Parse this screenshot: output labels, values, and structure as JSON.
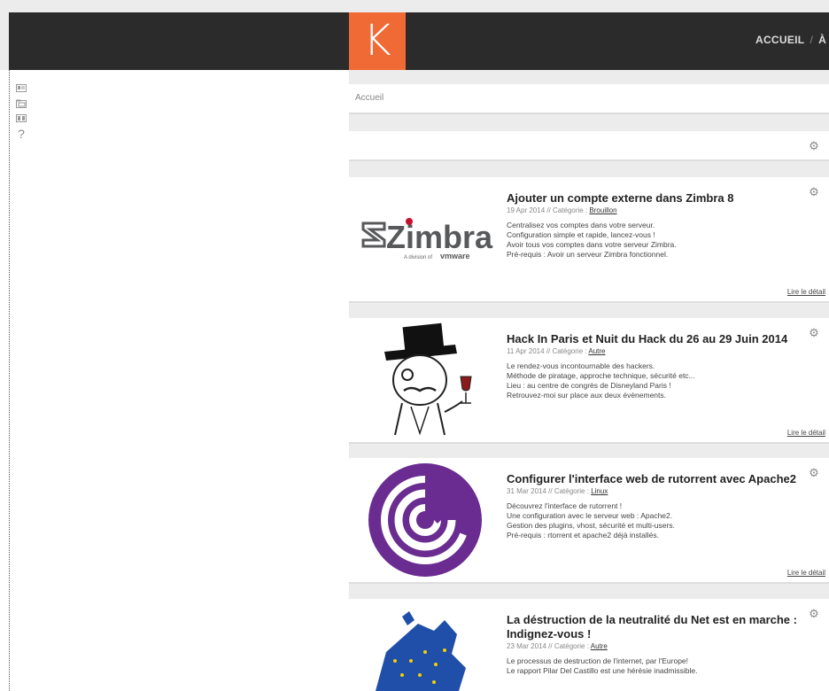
{
  "logo": "K",
  "nav": {
    "item1": "ACCUEIL",
    "sep": "/",
    "item2": "À"
  },
  "sidebar_icons": [
    "contact-card-icon",
    "folder-icon",
    "panel-icon",
    "help-icon"
  ],
  "help_glyph": "?",
  "breadcrumb": "Accueil",
  "gear_glyph": "⚙",
  "posts": [
    {
      "title": "Ajouter un compte externe dans Zimbra 8",
      "date": "19 Apr 2014",
      "cat_label": "Catégorie :",
      "category": "Brouillon",
      "desc": [
        "Centralisez vos comptes dans votre serveur.",
        "Configuration simple et rapide, lancez-vous !",
        "Avoir tous vos comptes dans votre serveur Zimbra.",
        "Pré-requis : Avoir un serveur Zimbra fonctionnel."
      ],
      "more": "Lire le détail",
      "thumb": {
        "brand": "Zimbra",
        "sub": "A division of",
        "sub2": "vmware"
      }
    },
    {
      "title": "Hack In Paris et Nuit du Hack du 26 au 29 Juin 2014",
      "date": "11 Apr 2014",
      "cat_label": "Catégorie :",
      "category": "Autre",
      "desc": [
        "Le rendez-vous incontournable des hackers.",
        "Méthode de piratage, approche technique, sécurité etc...",
        "Lieu : au centre de congrès de Disneyland Paris !",
        "Retrouvez-moi sur place aux deux évènements."
      ],
      "more": "Lire le détail"
    },
    {
      "title": "Configurer l'interface web de rutorrent avec Apache2",
      "date": "31 Mar 2014",
      "cat_label": "Catégorie :",
      "category": "Linux",
      "desc": [
        "Découvrez l'interface de rutorrent !",
        "Une configuration avec le serveur web : Apache2.",
        "Gestion des plugins, vhost, sécurité et multi-users.",
        "Pré-requis : rtorrent et apache2 déjà installés."
      ],
      "more": "Lire le détail"
    },
    {
      "title": "La déstruction de la neutralité du Net est en marche : Indignez-vous !",
      "date": "23 Mar 2014",
      "cat_label": "Catégorie :",
      "category": "Autre",
      "desc": [
        "Le processus de destruction de l'internet, par l'Europe!",
        "Le rapport Pilar Del Castillo est une hérésie inadmissible."
      ],
      "more": "Lire le détail"
    }
  ],
  "colors": {
    "accent": "#f06a35",
    "topbar": "#2b2b2b",
    "bittorrent": "#6a2c91",
    "eu_blue": "#1f4fa8"
  }
}
